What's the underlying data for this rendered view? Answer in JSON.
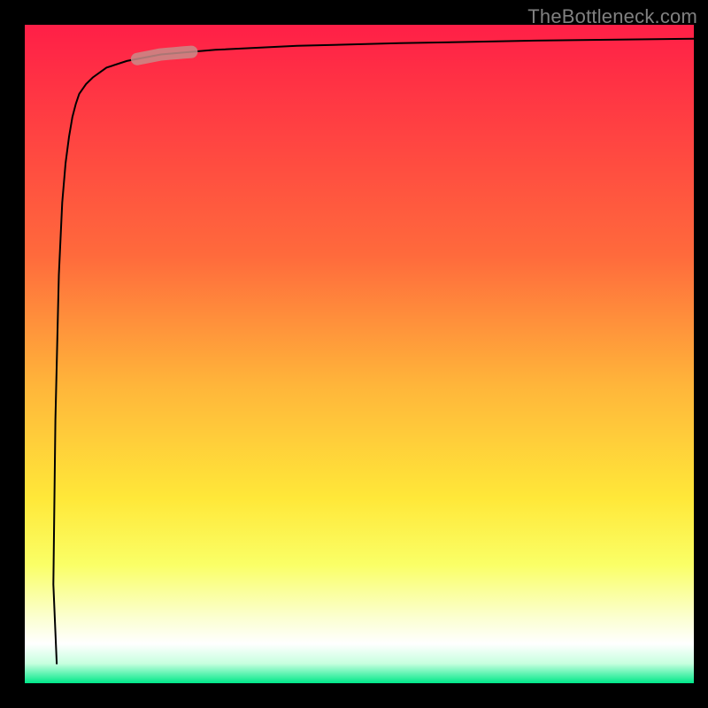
{
  "watermark": "TheBottleneck.com",
  "colors": {
    "border": "#000000",
    "curve": "#000000",
    "marker_fill": "#c98b88",
    "gradient_stops": [
      {
        "offset": 0.0,
        "color": "#ff1f47"
      },
      {
        "offset": 0.35,
        "color": "#ff6a3c"
      },
      {
        "offset": 0.55,
        "color": "#ffb63a"
      },
      {
        "offset": 0.72,
        "color": "#ffe839"
      },
      {
        "offset": 0.82,
        "color": "#faff66"
      },
      {
        "offset": 0.9,
        "color": "#fbffd0"
      },
      {
        "offset": 0.94,
        "color": "#ffffff"
      },
      {
        "offset": 0.97,
        "color": "#c7ffdf"
      },
      {
        "offset": 1.0,
        "color": "#00e889"
      }
    ]
  },
  "chart_data": {
    "type": "line",
    "title": "",
    "xlabel": "",
    "ylabel": "",
    "xlim": [
      0,
      100
    ],
    "ylim": [
      0,
      100
    ],
    "x": [
      4.7,
      4.2,
      4.5,
      5.0,
      5.5,
      6.0,
      6.5,
      7.0,
      7.5,
      8.0,
      9.0,
      10.0,
      12.0,
      15.0,
      20.0,
      28.0,
      40.0,
      55.0,
      75.0,
      100.0
    ],
    "values": [
      3.0,
      15.0,
      40.0,
      62.0,
      73.0,
      79.0,
      83.0,
      86.0,
      88.0,
      89.5,
      91.0,
      92.0,
      93.5,
      94.5,
      95.5,
      96.2,
      96.8,
      97.2,
      97.6,
      97.9
    ],
    "marker": {
      "x_range": [
        16.5,
        24.5
      ],
      "y_range": [
        88.8,
        92.0
      ]
    },
    "heat_axis": "y"
  }
}
